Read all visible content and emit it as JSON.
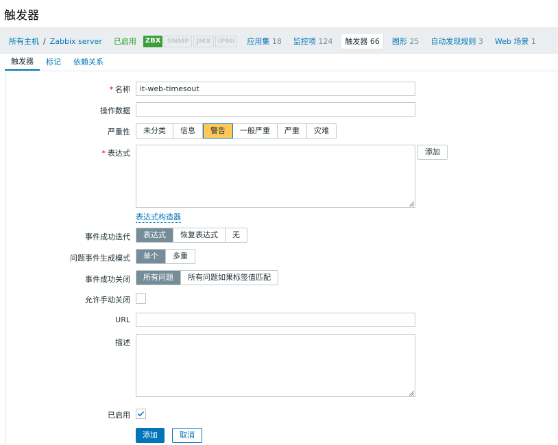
{
  "page": {
    "title": "触发器"
  },
  "breadcrumb": {
    "all_hosts": "所有主机",
    "separator": "/",
    "host": "Zabbix server",
    "status": "已启用",
    "availability": [
      {
        "label": "ZBX",
        "active": true
      },
      {
        "label": "SNMP",
        "active": false
      },
      {
        "label": "JMX",
        "active": false
      },
      {
        "label": "IPMI",
        "active": false
      }
    ],
    "items": [
      {
        "label": "应用集",
        "count": "18"
      },
      {
        "label": "监控项",
        "count": "124"
      },
      {
        "label": "触发器",
        "count": "66"
      },
      {
        "label": "图形",
        "count": "25"
      },
      {
        "label": "自动发现规则",
        "count": "3"
      },
      {
        "label": "Web 场景",
        "count": "1"
      }
    ]
  },
  "tabs": [
    {
      "label": "触发器"
    },
    {
      "label": "标记"
    },
    {
      "label": "依赖关系"
    }
  ],
  "form": {
    "name": {
      "label": "名称",
      "value": "it-web-timesout"
    },
    "opdata": {
      "label": "操作数据",
      "value": ""
    },
    "severity": {
      "label": "严重性",
      "options": [
        "未分类",
        "信息",
        "警告",
        "一般严重",
        "严重",
        "灾难"
      ],
      "selected": "警告"
    },
    "expression": {
      "label": "表达式",
      "value": "",
      "add_button": "添加",
      "builder_link": "表达式构造器"
    },
    "ok_event_gen": {
      "label": "事件成功迭代",
      "options": [
        "表达式",
        "恢复表达式",
        "无"
      ],
      "selected": "表达式"
    },
    "problem_mode": {
      "label": "问题事件生成模式",
      "options": [
        "单个",
        "多重"
      ],
      "selected": "单个"
    },
    "ok_close": {
      "label": "事件成功关闭",
      "options": [
        "所有问题",
        "所有问题如果标签值匹配"
      ],
      "selected": "所有问题"
    },
    "manual_close": {
      "label": "允许手动关闭",
      "checked": false
    },
    "url": {
      "label": "URL",
      "value": ""
    },
    "description": {
      "label": "描述",
      "value": ""
    },
    "enabled": {
      "label": "已启用",
      "checked": true
    }
  },
  "actions": {
    "add": "添加",
    "cancel": "取消"
  },
  "colors": {
    "link": "#0275b8",
    "nav_bg": "#ebeef0",
    "enabled_green": "#1a9c1a",
    "zbx_green": "#3a9e3a",
    "warning_yellow": "#ffc859",
    "selected_gray": "#768d99",
    "required_red": "#d40000"
  }
}
